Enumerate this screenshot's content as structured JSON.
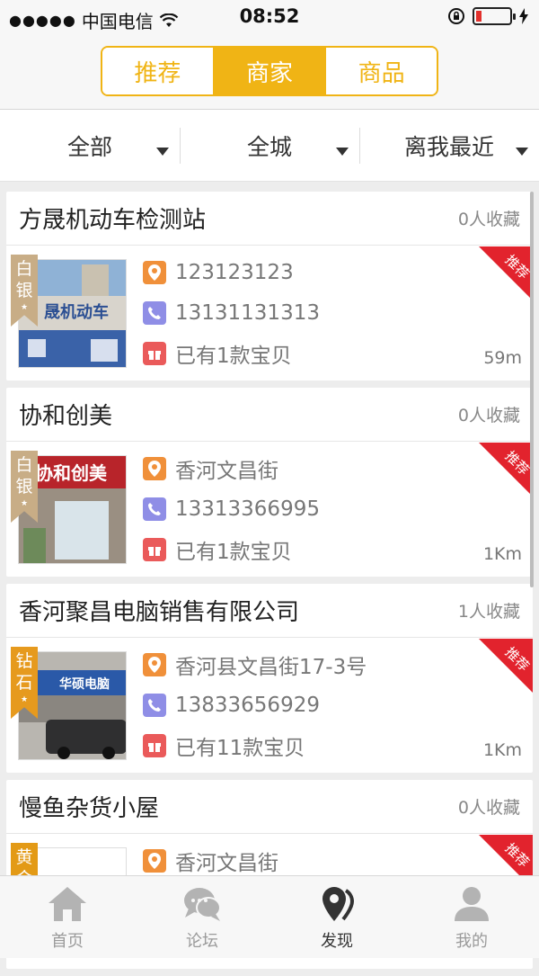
{
  "status": {
    "carrier": "中国电信",
    "time": "08:52"
  },
  "segments": [
    {
      "label": "推荐",
      "active": false
    },
    {
      "label": "商家",
      "active": true
    },
    {
      "label": "商品",
      "active": false
    }
  ],
  "filters": [
    "全部",
    "全城",
    "离我最近"
  ],
  "shops": [
    {
      "name": "方晟机动车检测站",
      "fav": "0人收藏",
      "level_line1": "白",
      "level_line2": "银",
      "address": "123123123",
      "phone": "13131131313",
      "items": "已有1款宝贝",
      "distance": "59m",
      "badge": "推荐",
      "thumb_text": "晟机动车",
      "thumb_color": "#3a62a8"
    },
    {
      "name": "协和创美",
      "fav": "0人收藏",
      "level_line1": "白",
      "level_line2": "银",
      "address": "香河文昌街",
      "phone": "13313366995",
      "items": "已有1款宝贝",
      "distance": "1Km",
      "badge": "推荐",
      "thumb_text": "协和创美",
      "thumb_color": "#b8242a"
    },
    {
      "name": "香河聚昌电脑销售有限公司",
      "fav": "1人收藏",
      "level_line1": "钻",
      "level_line2": "石",
      "address": "香河县文昌街17-3号",
      "phone": "13833656929",
      "items": "已有11款宝贝",
      "distance": "1Km",
      "badge": "推荐",
      "thumb_text": "华硕电脑",
      "thumb_color": "#2a59a8"
    },
    {
      "name": "慢鱼杂货小屋",
      "fav": "0人收藏",
      "level_line1": "黄",
      "level_line2": "金",
      "address": "香河文昌街",
      "phone": "",
      "items": "",
      "distance": "",
      "badge": "推荐",
      "thumb_text": "",
      "thumb_color": "#ffffff"
    }
  ],
  "tabs": [
    {
      "label": "首页",
      "icon": "home-icon",
      "active": false
    },
    {
      "label": "论坛",
      "icon": "chat-icon",
      "active": false
    },
    {
      "label": "发现",
      "icon": "discover-icon",
      "active": true
    },
    {
      "label": "我的",
      "icon": "user-icon",
      "active": false
    }
  ],
  "colors": {
    "accent": "#f0b415",
    "ribbon": "#e2232d",
    "location_icon": "#f0903a",
    "phone_icon": "#8f8ee6",
    "gift_icon": "#ea5a5a"
  }
}
